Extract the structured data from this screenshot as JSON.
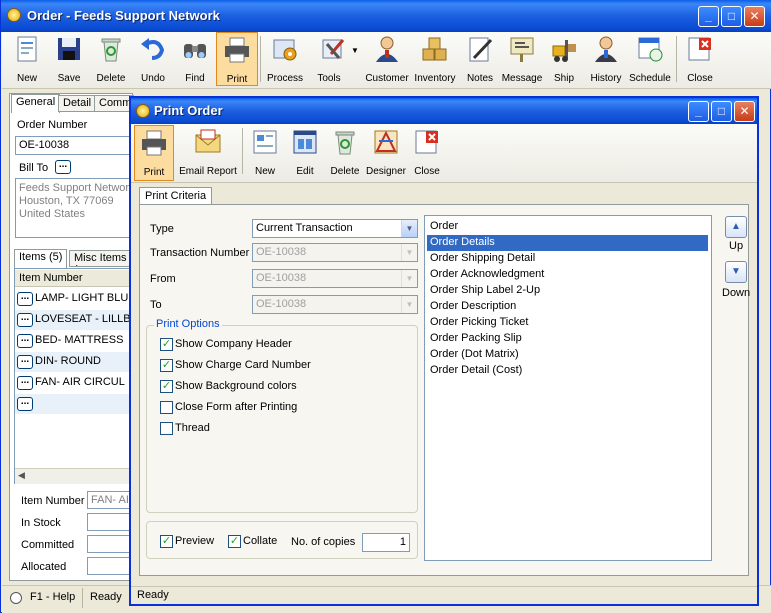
{
  "window": {
    "title": "Order - Feeds Support Network"
  },
  "toolbar": [
    {
      "label": "New"
    },
    {
      "label": "Save"
    },
    {
      "label": "Delete"
    },
    {
      "label": "Undo"
    },
    {
      "label": "Find"
    },
    {
      "label": "Print"
    },
    {
      "label": "Process"
    },
    {
      "label": "Tools"
    },
    {
      "label": "Customer"
    },
    {
      "label": "Inventory"
    },
    {
      "label": "Notes"
    },
    {
      "label": "Message"
    },
    {
      "label": "Ship"
    },
    {
      "label": "History"
    },
    {
      "label": "Schedule"
    },
    {
      "label": "Close"
    }
  ],
  "form": {
    "tabs": [
      "General",
      "Detail",
      "Comm"
    ],
    "order_number_label": "Order Number",
    "order_number": "OE-10038",
    "bill_to_label": "Bill To",
    "bill_to_lines": [
      "Feeds Support Networ",
      "Houston, TX 77069",
      "United States"
    ],
    "item_tabs": [
      "Items (5)",
      "Misc Items ("
    ],
    "item_header": "Item Number",
    "items": [
      "LAMP- LIGHT BLUE",
      "LOVESEAT - LILLBI",
      "BED- MATTRESS",
      "DIN- ROUND",
      "FAN- AIR CIRCUL",
      ""
    ],
    "item_number_label": "Item Number",
    "item_number_value": "FAN- AIR",
    "in_stock_label": "In Stock",
    "committed_label": "Committed",
    "allocated_label": "Allocated"
  },
  "status": {
    "help": "F1 - Help",
    "text": "Ready"
  },
  "dialog": {
    "title": "Print Order",
    "toolbar": [
      {
        "label": "Print"
      },
      {
        "label": "Email Report"
      },
      {
        "label": "New"
      },
      {
        "label": "Edit"
      },
      {
        "label": "Delete"
      },
      {
        "label": "Designer"
      },
      {
        "label": "Close"
      }
    ],
    "tab": "Print Criteria",
    "type_label": "Type",
    "type_value": "Current Transaction",
    "txn_label": "Transaction Number",
    "txn_value": "OE-10038",
    "from_label": "From",
    "from_value": "OE-10038",
    "to_label": "To",
    "to_value": "OE-10038",
    "print_options_label": "Print Options",
    "options": [
      {
        "label": "Show Company Header",
        "checked": true
      },
      {
        "label": "Show Charge Card Number",
        "checked": true
      },
      {
        "label": "Show Background colors",
        "checked": true
      },
      {
        "label": "Close Form after Printing",
        "checked": false
      },
      {
        "label": "Thread",
        "checked": false
      }
    ],
    "preview_label": "Preview",
    "collate_label": "Collate",
    "copies_label": "No. of copies",
    "copies_value": "1",
    "reports": [
      "Order",
      "Order Details",
      "Order Shipping Detail",
      "Order Acknowledgment",
      "Order Ship Label 2-Up",
      "Order Description",
      "Order Picking Ticket",
      "Order Packing Slip",
      "Order (Dot Matrix)",
      "Order Detail (Cost)"
    ],
    "selected_report": 1,
    "up_label": "Up",
    "down_label": "Down",
    "status": "Ready"
  },
  "colors": {
    "accent": "#316ac5",
    "title_bar": "#0a5ee6",
    "active_tool": "#fddca0"
  }
}
